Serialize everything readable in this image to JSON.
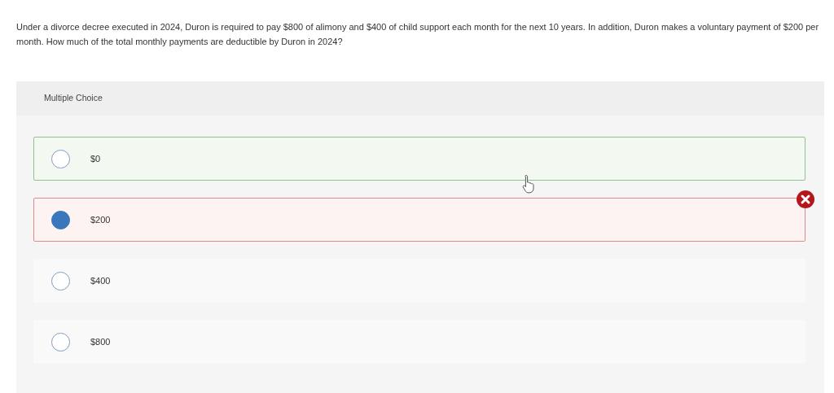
{
  "question": "Under a divorce decree executed in 2024, Duron is required to pay $800 of alimony and $400 of child support each month for the next 10 years. In addition, Duron makes a voluntary payment of $200 per month. How much of the total monthly payments are deductible by Duron in 2024?",
  "panel": {
    "title": "Multiple Choice"
  },
  "options": [
    {
      "label": "$0",
      "selected": false,
      "correct": true,
      "incorrect": false
    },
    {
      "label": "$200",
      "selected": true,
      "correct": false,
      "incorrect": true
    },
    {
      "label": "$400",
      "selected": false,
      "correct": false,
      "incorrect": false
    },
    {
      "label": "$800",
      "selected": false,
      "correct": false,
      "incorrect": false
    }
  ]
}
